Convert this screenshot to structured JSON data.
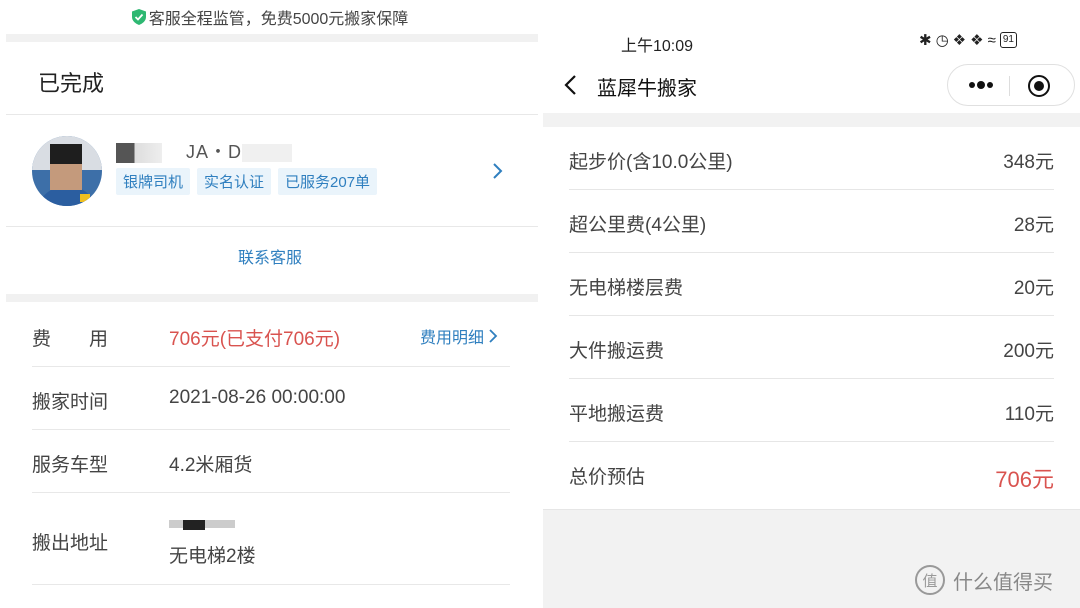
{
  "left": {
    "guarantee_text": "客服全程监管，免费5000元搬家保障",
    "order_status": "已完成",
    "driver": {
      "name_partial": "JA・D",
      "tags": [
        "银牌司机",
        "实名认证",
        "已服务207单"
      ]
    },
    "contact_label": "联系客服",
    "fee": {
      "label": "费　　用",
      "value": "706元(已支付706元)",
      "detail_link": "费用明细"
    },
    "move_time": {
      "label": "搬家时间",
      "value": "2021-08-26 00:00:00"
    },
    "vehicle": {
      "label": "服务车型",
      "value": "4.2米厢货"
    },
    "origin": {
      "label": "搬出地址",
      "value": "无电梯2楼"
    }
  },
  "right": {
    "status_time": "上午10:09",
    "battery": "91",
    "title": "蓝犀牛搬家",
    "fees": [
      {
        "name": "起步价(含10.0公里)",
        "amount": "348元"
      },
      {
        "name": "超公里费(4公里)",
        "amount": "28元"
      },
      {
        "name": "无电梯楼层费",
        "amount": "20元"
      },
      {
        "name": "大件搬运费",
        "amount": "200元"
      },
      {
        "name": "平地搬运费",
        "amount": "110元"
      }
    ],
    "total": {
      "name": "总价预估",
      "amount": "706元"
    },
    "watermark": "什么值得买",
    "watermark_icon": "值"
  },
  "colors": {
    "accent_blue": "#2f7fbf",
    "price_red": "#d9534f",
    "check_green": "#2eb872"
  }
}
